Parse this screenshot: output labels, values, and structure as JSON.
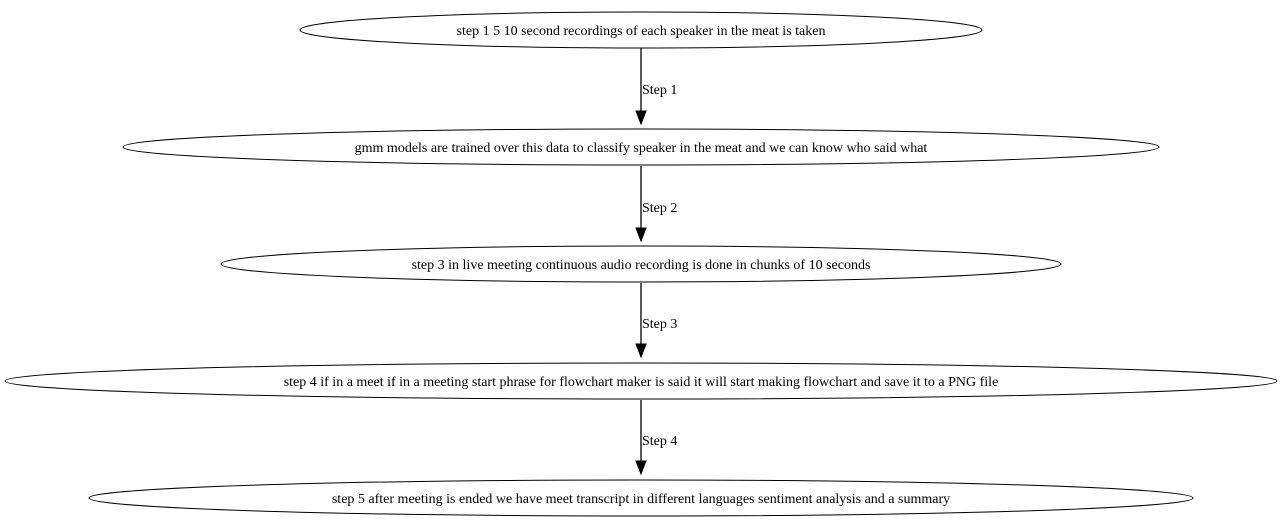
{
  "nodes": [
    {
      "label": "step 1 5 10 second recordings of each speaker in the meat is taken"
    },
    {
      "label": "gmm models are trained over this data to classify speaker in the meat and we can know who said what"
    },
    {
      "label": "step 3 in live meeting continuous audio recording is done in chunks of 10 seconds"
    },
    {
      "label": "step 4 if in a meet if in a meeting start phrase for flowchart maker is said it will start making flowchart and save it to a PNG file"
    },
    {
      "label": "step 5 after meeting is ended we have meet transcript in different languages sentiment analysis and a summary"
    }
  ],
  "edges": [
    {
      "from": 0,
      "to": 1,
      "label": "Step 1"
    },
    {
      "from": 1,
      "to": 2,
      "label": "Step 2"
    },
    {
      "from": 2,
      "to": 3,
      "label": "Step 3"
    },
    {
      "from": 3,
      "to": 4,
      "label": "Step 4"
    }
  ]
}
